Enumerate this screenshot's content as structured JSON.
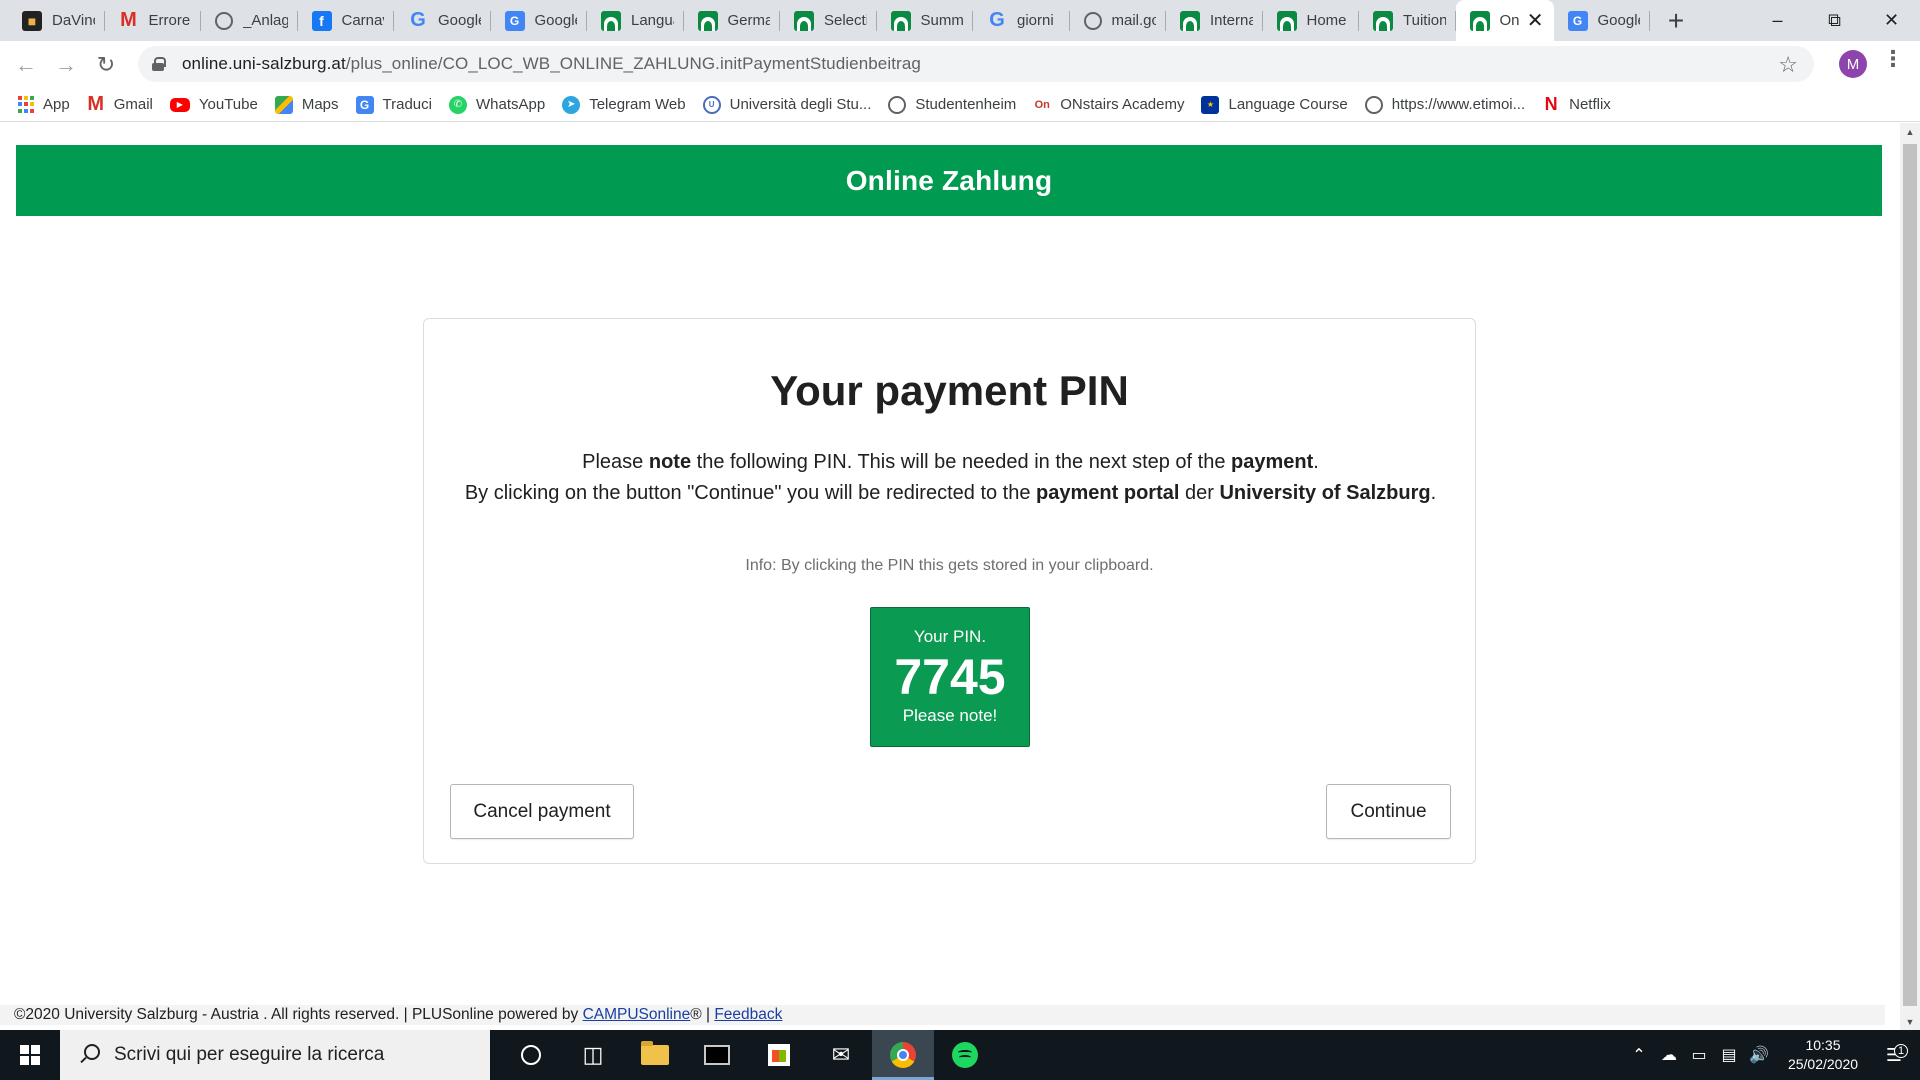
{
  "browser": {
    "tabs": [
      {
        "title": "DaVinc",
        "icon": "davinci-icon"
      },
      {
        "title": "Errore",
        "icon": "gmail-icon"
      },
      {
        "title": "_Anlag",
        "icon": "globe-icon"
      },
      {
        "title": "Carnav",
        "icon": "facebook-icon"
      },
      {
        "title": "Google",
        "icon": "google-icon"
      },
      {
        "title": "Google",
        "icon": "google-translate-icon"
      },
      {
        "title": "Langua",
        "icon": "plusonline-icon"
      },
      {
        "title": "Germa",
        "icon": "plusonline-icon"
      },
      {
        "title": "Selecti",
        "icon": "plusonline-icon"
      },
      {
        "title": "Summ",
        "icon": "plusonline-icon"
      },
      {
        "title": "giorni",
        "icon": "google-icon"
      },
      {
        "title": "mail.gc",
        "icon": "globe-icon"
      },
      {
        "title": "Interna",
        "icon": "plusonline-icon"
      },
      {
        "title": "Home",
        "icon": "plusonline-icon"
      },
      {
        "title": "Tuition",
        "icon": "plusonline-icon"
      },
      {
        "title": "On",
        "icon": "plusonline-icon",
        "active": true
      },
      {
        "title": "Google",
        "icon": "google-translate-icon"
      }
    ],
    "new_tab_symbol": "+",
    "window_controls": {
      "minimize": "–",
      "maximize": "⧉",
      "close": "✕"
    },
    "url_host": "online.uni-salzburg.at",
    "url_path": "/plus_online/CO_LOC_WB_ONLINE_ZAHLUNG.initPaymentStudienbeitrag",
    "profile_initial": "M",
    "bookmarks": [
      {
        "label": "App",
        "icon": "apps-grid-icon"
      },
      {
        "label": "Gmail",
        "icon": "gmail-icon"
      },
      {
        "label": "YouTube",
        "icon": "youtube-icon"
      },
      {
        "label": "Maps",
        "icon": "maps-icon"
      },
      {
        "label": "Traduci",
        "icon": "google-translate-icon"
      },
      {
        "label": "WhatsApp",
        "icon": "whatsapp-icon"
      },
      {
        "label": "Telegram Web",
        "icon": "telegram-icon"
      },
      {
        "label": "Università degli Stu...",
        "icon": "university-icon"
      },
      {
        "label": "Studentenheim",
        "icon": "globe-icon"
      },
      {
        "label": "ONstairs Academy",
        "icon": "onstairs-icon"
      },
      {
        "label": "Language Course",
        "icon": "eu-flag-icon"
      },
      {
        "label": "https://www.etimoi...",
        "icon": "globe-icon"
      },
      {
        "label": "Netflix",
        "icon": "netflix-icon"
      }
    ]
  },
  "page": {
    "header_title": "Online Zahlung",
    "card_title": "Your payment PIN",
    "text": {
      "l1_a": "Please ",
      "l1_b": "note",
      "l1_c": " the following PIN. This will be needed in the next step of the ",
      "l1_d": "payment",
      "l1_e": ".",
      "l2_a": "By clicking on the button \"Continue\" you will be redirected to the ",
      "l2_b": "payment portal",
      "l2_c": " der ",
      "l2_d": "University of Salzburg",
      "l2_e": "."
    },
    "info_small": "Info: By clicking the PIN this gets stored in your clipboard.",
    "pin": {
      "label": "Your PIN.",
      "value": "7745",
      "note": "Please note!"
    },
    "buttons": {
      "cancel": "Cancel payment",
      "continue": "Continue"
    },
    "footer": {
      "text": "©2020 University Salzburg - Austria . All rights reserved. | PLUSonline powered by ",
      "link1": "CAMPUSonline",
      "mid": "® | ",
      "link2": "Feedback"
    },
    "colors": {
      "header_green": "#009a50",
      "pin_green": "#0b9a52"
    }
  },
  "taskbar": {
    "search_placeholder": "Scrivi qui per eseguire la ricerca",
    "time": "10:35",
    "date": "25/02/2020",
    "notification_count": "1"
  }
}
